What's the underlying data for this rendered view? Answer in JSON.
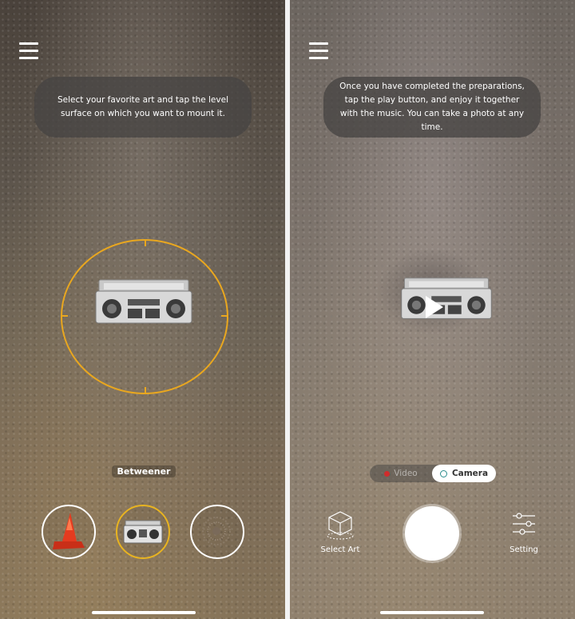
{
  "left_screen": {
    "hint_text": "Select your favorite art and tap the level surface on which you want to mount it.",
    "selected_art_label": "Betweener",
    "art_thumbnails": [
      {
        "name": "cone"
      },
      {
        "name": "boombox"
      },
      {
        "name": "ornament"
      }
    ],
    "accent_color": "#e9a71f"
  },
  "right_screen": {
    "hint_text": "Once you have completed the preparations, tap the play button, and enjoy it together with the music. You can take a photo at any time.",
    "mode_video_label": "Video",
    "mode_camera_label": "Camera",
    "select_art_label": "Select Art",
    "setting_label": "Setting"
  }
}
